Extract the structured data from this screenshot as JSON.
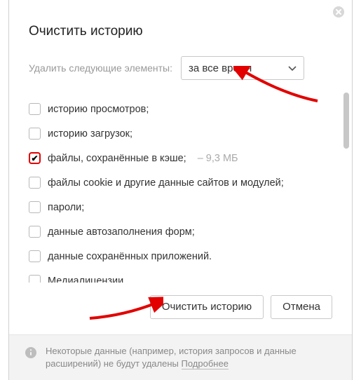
{
  "title": "Очистить историю",
  "range_label": "Удалить следующие элементы:",
  "range_selected": "за все время",
  "options": [
    {
      "label": "историю просмотров;",
      "checked": false
    },
    {
      "label": "историю загрузок;",
      "checked": false
    },
    {
      "label": "файлы, сохранённые в кэше;",
      "checked": true,
      "extra": "–  9,3 МБ"
    },
    {
      "label": "файлы cookie и другие данные сайтов и модулей;",
      "checked": false
    },
    {
      "label": "пароли;",
      "checked": false
    },
    {
      "label": "данные автозаполнения форм;",
      "checked": false
    },
    {
      "label": "данные сохранённых приложений.",
      "checked": false
    },
    {
      "label": "Медиалицензии",
      "checked": false
    }
  ],
  "buttons": {
    "primary": "Очистить историю",
    "cancel": "Отмена"
  },
  "footer": {
    "text": "Некоторые данные (например, история запросов и данные расширений) не будут удалены ",
    "link": "Подробнее"
  }
}
